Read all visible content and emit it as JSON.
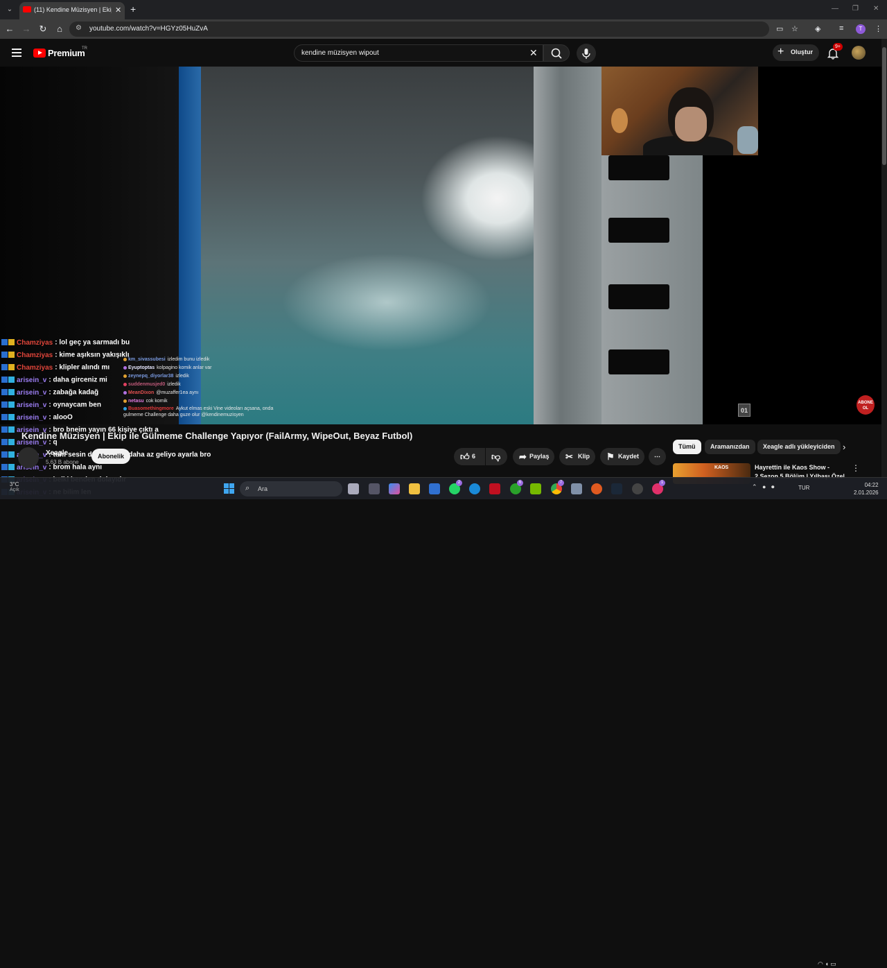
{
  "browser": {
    "tab_title": "(11) Kendine Müzisyen | Ekip ile Gülmeme Challenge Yapıyor",
    "tab_close": "✕",
    "new_tab": "+",
    "url": "youtube.com/watch?v=HGYz05HuZvA",
    "profile_initial": "T"
  },
  "youtube": {
    "logo_text": "Premium",
    "country": "TR",
    "search_query": "kendine müzisyen wipout",
    "create_label": "Oluştur",
    "notif_count": "9+"
  },
  "video": {
    "title": "Kendine Müzisyen | Ekip ile Gülmeme Challenge Yapıyor (FailArmy, WipeOut, Beyaz Futbol)",
    "watermark": "01",
    "abone_label": "ABONE OL"
  },
  "channel": {
    "name": "Xeagle",
    "subs": "5,63 B abone",
    "joined_label": "Abonelik"
  },
  "actions": {
    "like_count": "6",
    "share_label": "Paylaş",
    "clip_label": "Klip",
    "save_label": "Kaydet",
    "more_label": "⋯"
  },
  "inner_chat": [
    {
      "user": "km_sivassubesi",
      "msg": "izledim bunu izledik",
      "color": "#7a9ae0",
      "badge": "#e0a030"
    },
    {
      "user": "Eyuptoptas",
      "msg": "kolpagino komik anlar var",
      "color": "#e8e8ff",
      "badge": "#b070e0"
    },
    {
      "user": "zeynepq_diyorlar38",
      "msg": "izledik",
      "color": "#7a9ae0",
      "badge": "#e0a030"
    },
    {
      "user": "suddenmusjed0",
      "msg": "izledik",
      "color": "#c05a7a",
      "badge": "#e04060"
    },
    {
      "user": "MeanDixon",
      "msg": "@muzaffer1ea aynı",
      "color": "#e05050",
      "badge": "#b070e0"
    },
    {
      "user": "netasu",
      "msg": "cok komik",
      "color": "#e07ae0",
      "badge": "#e0a030"
    },
    {
      "user": "Buasomethingmore",
      "msg": "Aykut elmas eski Vine videoları açsana, onda gulmeme Challenge daha guze olur @kendinemuzisyen",
      "color": "#e03a3a",
      "badge": "#30a0e0"
    }
  ],
  "overlay_chat": [
    {
      "user": "Chamziyas",
      "msg": ": lol geç ya sarmadı bu",
      "color": "#e0453a",
      "badges": [
        "#2a6fd0",
        "#e0b020"
      ]
    },
    {
      "user": "Chamziyas",
      "msg": ": kime aşıksın yakışıklı",
      "color": "#e0453a",
      "badges": [
        "#2a6fd0",
        "#e0b020"
      ]
    },
    {
      "user": "Chamziyas",
      "msg": ": klipler alındı mı",
      "color": "#e0453a",
      "badges": [
        "#2a6fd0",
        "#e0b020"
      ]
    },
    {
      "user": "arisein_v",
      "msg": ": daha girceniz mi",
      "color": "#9a7cf0",
      "badges": [
        "#2a6fd0",
        "#30b0e0"
      ]
    },
    {
      "user": "arisein_v",
      "msg": ": zabağa kadağ",
      "color": "#9a7cf0",
      "badges": [
        "#2a6fd0",
        "#30b0e0"
      ]
    },
    {
      "user": "arisein_v",
      "msg": ": oynaycam ben",
      "color": "#9a7cf0",
      "badges": [
        "#2a6fd0",
        "#30b0e0"
      ]
    },
    {
      "user": "arisein_v",
      "msg": ": alooO",
      "color": "#9a7cf0",
      "badges": [
        "#2a6fd0",
        "#30b0e0"
      ]
    },
    {
      "user": "arisein_v",
      "msg": ": bro bneim yayın 66 kişiye çıktı a",
      "color": "#9a7cf0",
      "badges": [
        "#2a6fd0",
        "#30b0e0"
      ]
    },
    {
      "user": "arisein_v",
      "msg": ": q",
      "color": "#9a7cf0",
      "badges": [
        "#2a6fd0",
        "#30b0e0"
      ]
    },
    {
      "user": "arisein_v",
      "msg": ": tuhf sesin düşebilir mi daha az geliyo ayarla bro",
      "color": "#9a7cf0",
      "badges": [
        "#2a6fd0",
        "#30b0e0"
      ]
    },
    {
      "user": "arisein_v",
      "msg": ": brom hala aynı",
      "color": "#9a7cf0",
      "badges": [
        "#2a6fd0",
        "#30b0e0"
      ]
    },
    {
      "user": "arisein_v",
      "msg": ": belki benden dolayıdır",
      "color": "#9a7cf0",
      "badges": [
        "#2a6fd0",
        "#30b0e0"
      ]
    },
    {
      "user": "arisein_v",
      "msg": ": ne bilim len",
      "color": "#9a7cf0",
      "badges": [
        "#2a6fd0",
        "#30b0e0"
      ]
    }
  ],
  "related": {
    "chips": [
      "Tümü",
      "Aramanızdan",
      "Xeagle adlı yükleyiciden"
    ],
    "first_title": "Hayrettin ile Kaos Show - 2.Sezon 5.Bölüm | Yılbaşı Özel",
    "first_thumb_tag": "KAOS"
  },
  "taskbar": {
    "weather_temp": "3°C",
    "weather_desc": "Açık",
    "search_placeholder": "Ara",
    "lang": "TUR",
    "time": "04:22",
    "date": "2.01.2026",
    "badge_2": "2",
    "badge_6": "6",
    "badge_7": "7",
    "badge_1": "1"
  }
}
